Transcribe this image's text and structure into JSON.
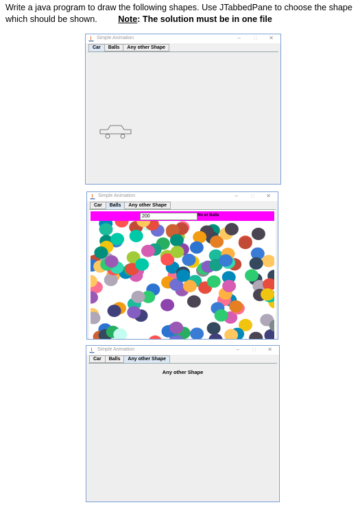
{
  "instructions": {
    "line1": "Write a java program to draw the following shapes. Use JTabbedPane to choose the shape",
    "line2": "which should be shown.",
    "note_label": "Note",
    "note_text": ": The solution must be in one file"
  },
  "window": {
    "title": "Simple Animation",
    "minimize": "–",
    "maximize": "□",
    "close": "✕"
  },
  "tabs": [
    "Car",
    "Balls",
    "Any other Shape"
  ],
  "balls_panel": {
    "count_value": "200",
    "count_label": "No of Balls"
  },
  "other_panel": {
    "label": "Any other Shape"
  },
  "colors": {
    "accent_magenta": "#ff00ff",
    "window_border": "#7aa0d4",
    "tab_selected": "#dce8f5"
  }
}
